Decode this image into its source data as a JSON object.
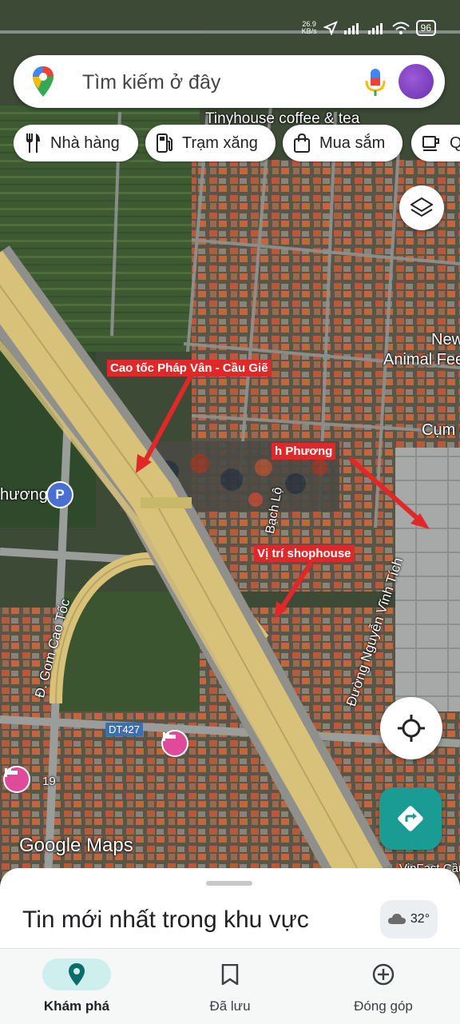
{
  "status": {
    "speed_value": "26.9",
    "speed_unit": "KB/s",
    "battery": "96"
  },
  "search": {
    "placeholder": "Tìm kiếm ở đây"
  },
  "chips": [
    {
      "label": "Nhà hàng",
      "icon": "fork-knife-icon"
    },
    {
      "label": "Trạm xăng",
      "icon": "gas-station-icon"
    },
    {
      "label": "Mua sắm",
      "icon": "shopping-bag-icon"
    },
    {
      "label": "Q",
      "icon": "coffee-icon"
    }
  ],
  "map_labels": {
    "tinyhouse": "Tinyhouse coffee & tea",
    "animal_feed_1": "New",
    "animal_feed_2": "Animal Fee",
    "cum": "Cụm C",
    "phuong": "hương",
    "bach": "Bạch Lộ",
    "nguyen_vinh_tich": "Đường Nguyễn Vĩnh Tích",
    "gom_cao_toc": "Đ. Gom Cao Tốc",
    "dt427": "DT427",
    "num19": "19",
    "vinfast": "VinFast Cầu",
    "google_maps": "Google Maps"
  },
  "annotations": {
    "expressway": "Cao tốc Pháp Vân - Cầu Giẽ",
    "street": "h Phương",
    "shophouse": "Vị trí shophouse"
  },
  "controls": {
    "layers_icon": "layers-icon",
    "locate_icon": "crosshair-icon",
    "directions_icon": "directions-icon"
  },
  "sheet": {
    "title": "Tin mới nhất trong khu vực",
    "temperature": "32°"
  },
  "nav": [
    {
      "label": "Khám phá",
      "icon": "explore-pin-icon",
      "active": true
    },
    {
      "label": "Đã lưu",
      "icon": "bookmark-icon",
      "active": false
    },
    {
      "label": "Đóng góp",
      "icon": "add-circle-icon",
      "active": false
    }
  ],
  "colors": {
    "accent": "#1a9c95",
    "highway": "#d8c27a",
    "annotation_red": "#e02828"
  }
}
